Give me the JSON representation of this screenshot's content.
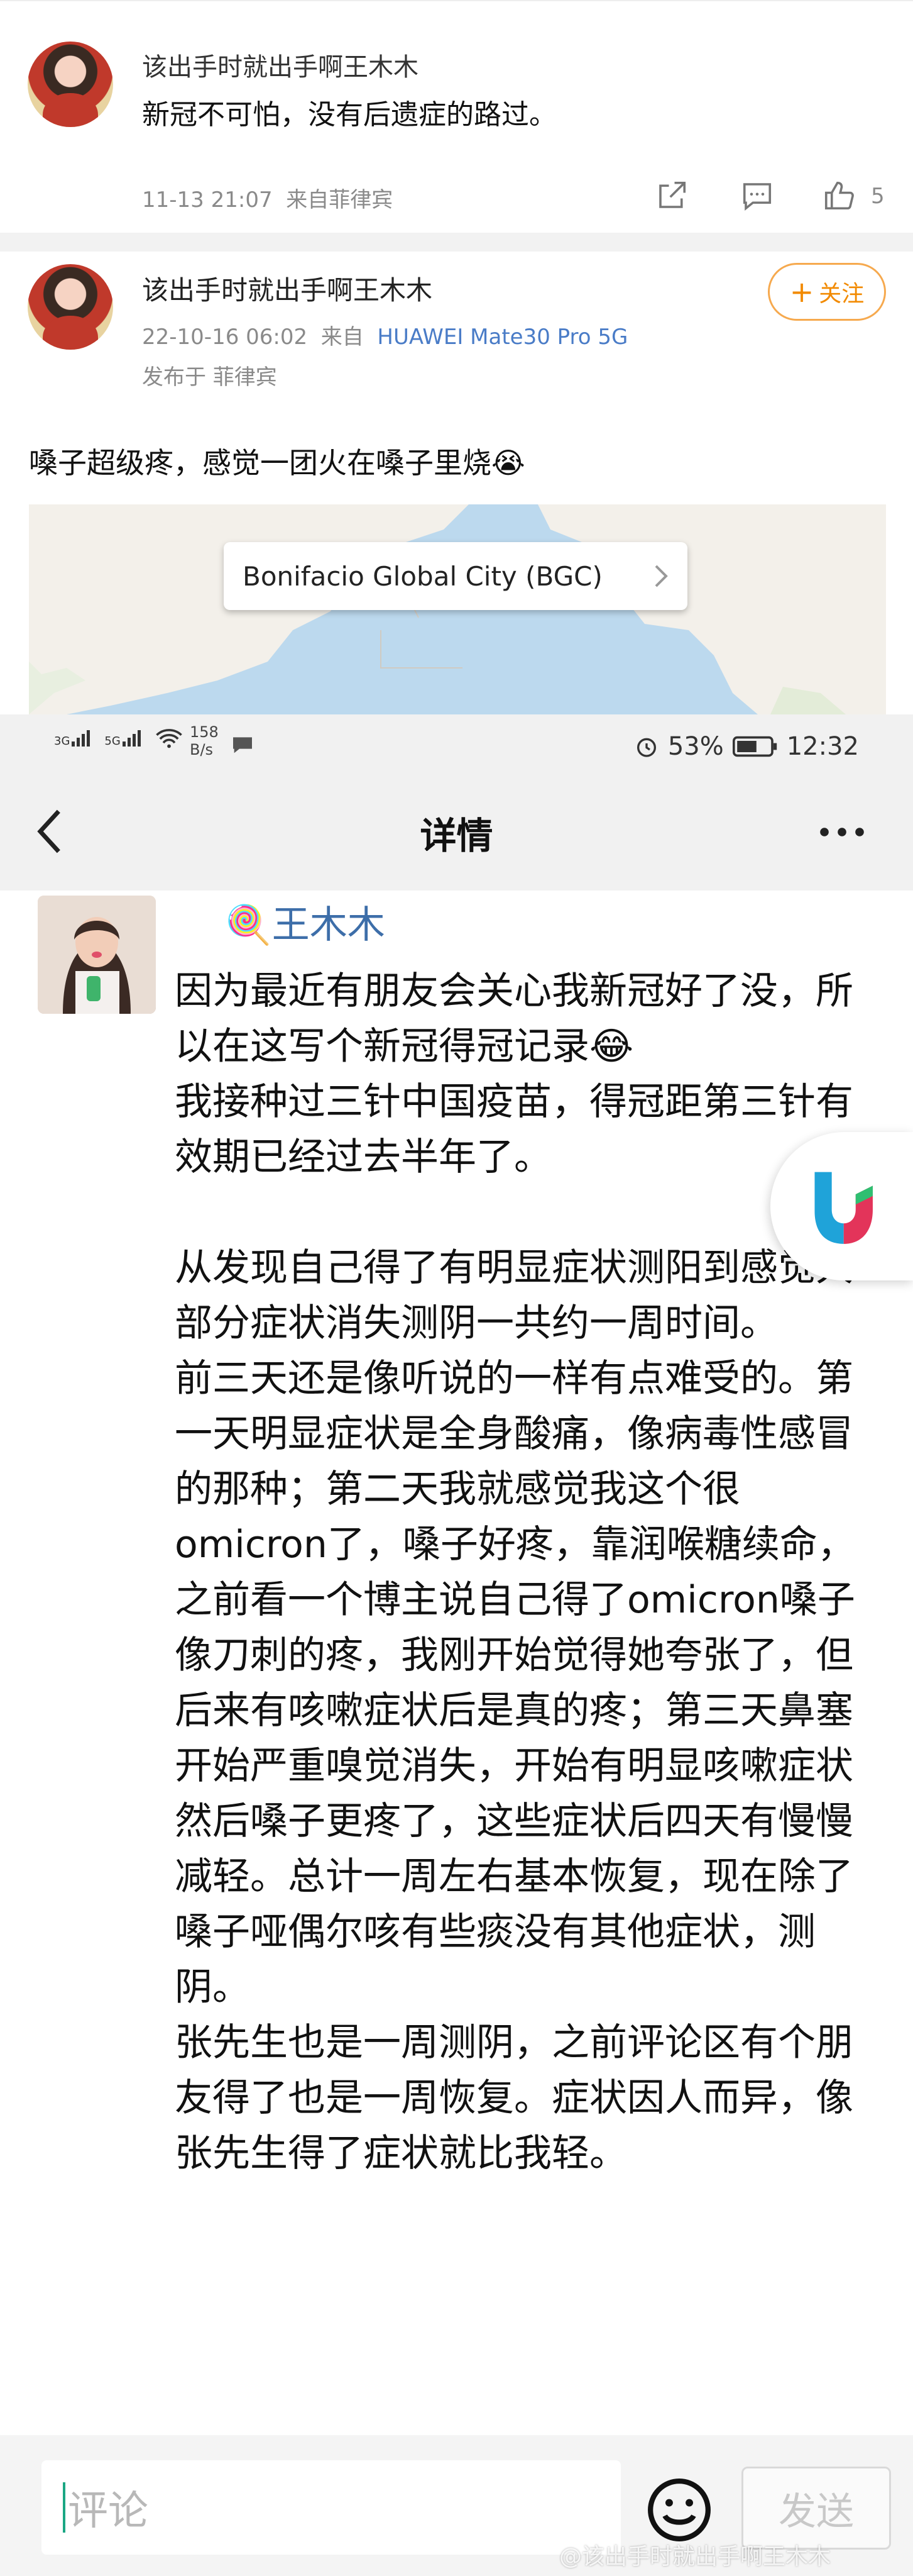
{
  "top_comment": {
    "username": "该出手时就出手啊王木木",
    "text": "新冠不可怕，没有后遗症的路过。",
    "time": "11-13 21:07",
    "source": "来自菲律宾",
    "like_count": "5"
  },
  "post": {
    "username": "该出手时就出手啊王木木",
    "date": "22-10-16 06:02",
    "from_label": "来自",
    "device": "HUAWEI Mate30 Pro 5G",
    "published_in": "发布于 菲律宾",
    "follow_label": "关注",
    "text": "嗓子超级疼，感觉一团火在嗓子里烧😭",
    "location": "Bonifacio Global City (BGC)"
  },
  "status_bar": {
    "network1": "3G",
    "network2": "5G",
    "speed": "158",
    "speed_unit": "B/s",
    "battery": "53%",
    "time": "12:32"
  },
  "nav": {
    "title": "详情"
  },
  "detail": {
    "name": "王木木",
    "paragraphs": [
      "因为最近有朋友会关心我新冠好了没，所以在这写个新冠得冠记录😂",
      "我接种过三针中国疫苗，得冠距第三针有效期已经过去半年了。",
      "",
      "从发现自己得了有明显症状测阳到感觉大部分症状消失测阴一共约一周时间。",
      "前三天还是像听说的一样有点难受的。第一天明显症状是全身酸痛，像病毒性感冒的那种；第二天我就感觉我这个很omicron了，嗓子好疼，靠润喉糖续命，之前看一个博主说自己得了omicron嗓子像刀刺的疼，我刚开始觉得她夸张了，但后来有咳嗽症状后是真的疼；第三天鼻塞开始严重嗅觉消失，开始有明显咳嗽症状然后嗓子更疼了，这些症状后四天有慢慢减轻。总计一周左右基本恢复，现在除了嗓子哑偶尔咳有些痰没有其他症状，测阴。",
      "张先生也是一周测阴，之前评论区有个朋友得了也是一周恢复。症状因人而异，像张先生得了症状就比我轻。"
    ]
  },
  "bottom_bar": {
    "comment_placeholder": "评论",
    "send_label": "发送",
    "watermark": "@该出手时就出手啊王木木"
  },
  "colors": {
    "link_blue": "#3d6ea9",
    "follow_orange": "#f28a00",
    "device_blue": "#4a7cc7"
  }
}
